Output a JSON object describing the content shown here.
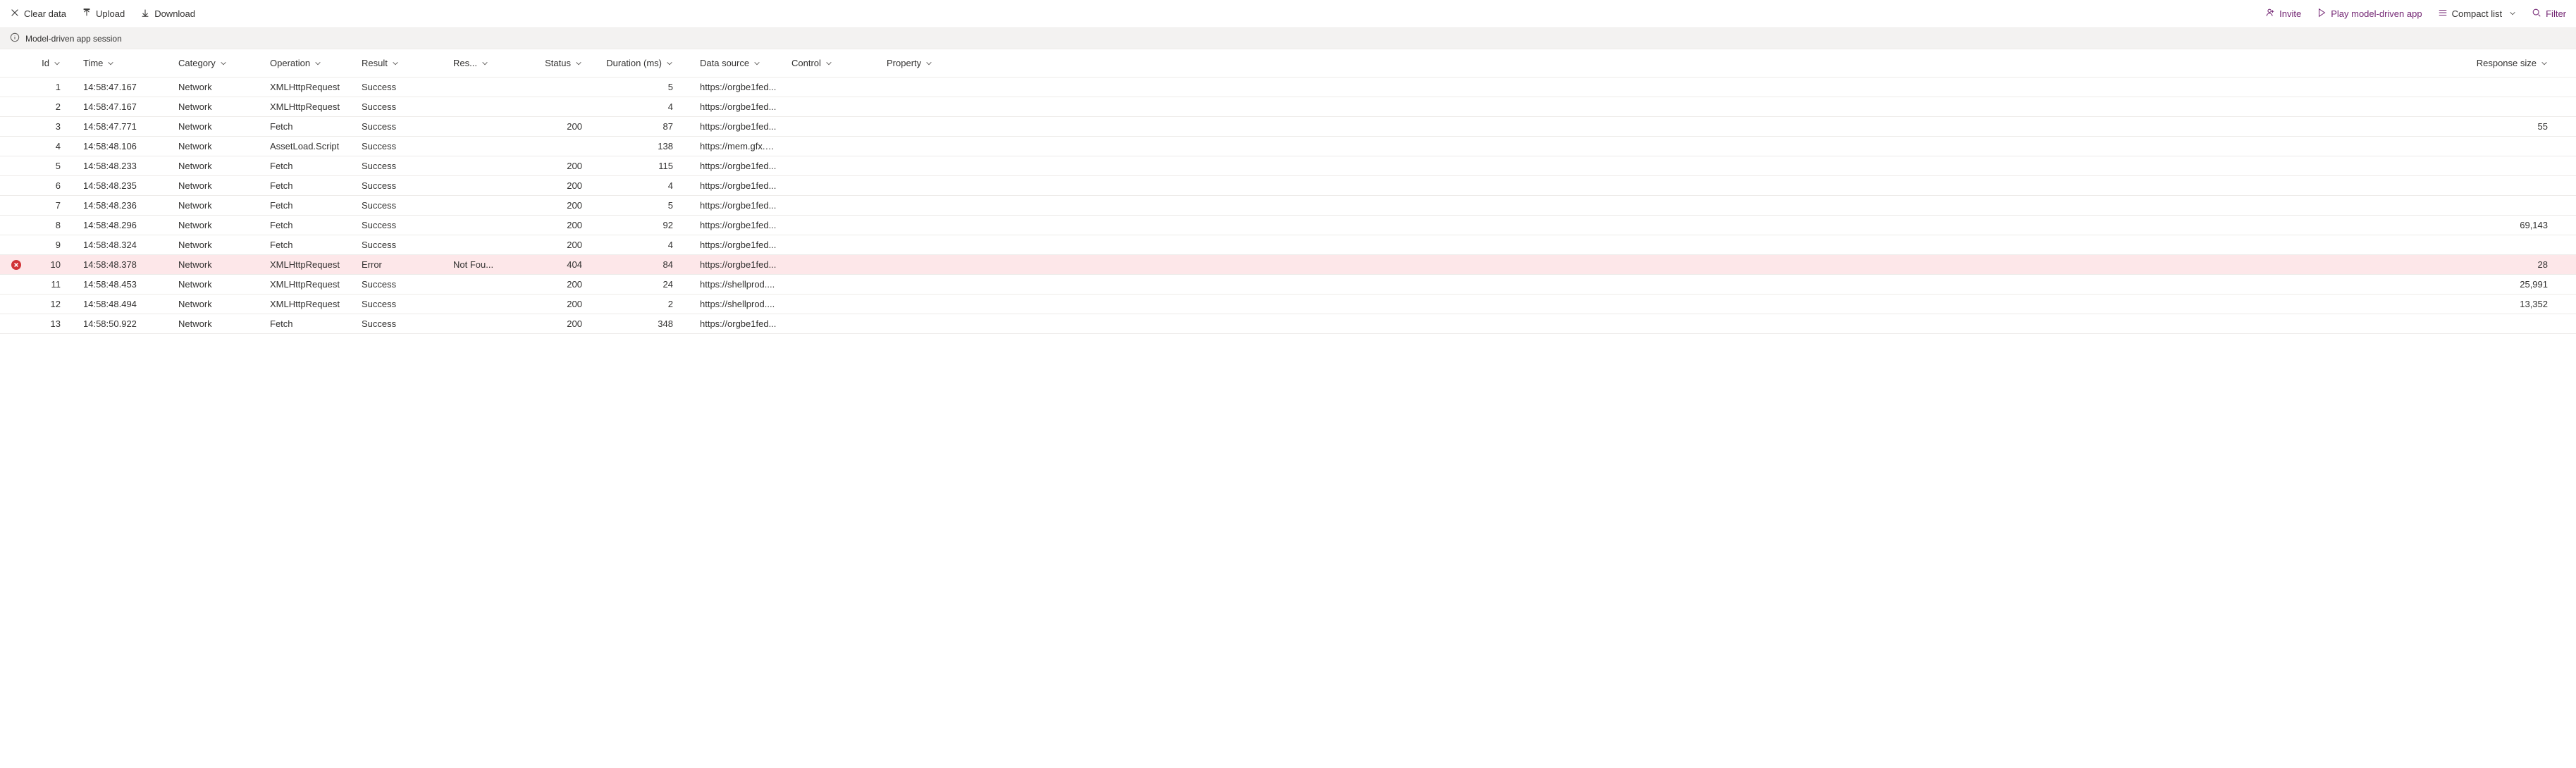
{
  "toolbar": {
    "clear_data": "Clear data",
    "upload": "Upload",
    "download": "Download",
    "invite": "Invite",
    "play": "Play model-driven app",
    "compact": "Compact list",
    "filter": "Filter"
  },
  "infobar": {
    "text": "Model-driven app session"
  },
  "columns": {
    "id": "Id",
    "time": "Time",
    "category": "Category",
    "operation": "Operation",
    "result": "Result",
    "res2": "Res...",
    "status": "Status",
    "duration": "Duration (ms)",
    "datasource": "Data source",
    "control": "Control",
    "property": "Property",
    "response_size": "Response size"
  },
  "rows": [
    {
      "id": "1",
      "time": "14:58:47.167",
      "cat": "Network",
      "op": "XMLHttpRequest",
      "result": "Success",
      "res2": "",
      "status": "",
      "dur": "5",
      "ds": "https://orgbe1fed...",
      "ctrl": "",
      "prop": "",
      "resp": "",
      "error": false
    },
    {
      "id": "2",
      "time": "14:58:47.167",
      "cat": "Network",
      "op": "XMLHttpRequest",
      "result": "Success",
      "res2": "",
      "status": "",
      "dur": "4",
      "ds": "https://orgbe1fed...",
      "ctrl": "",
      "prop": "",
      "resp": "",
      "error": false
    },
    {
      "id": "3",
      "time": "14:58:47.771",
      "cat": "Network",
      "op": "Fetch",
      "result": "Success",
      "res2": "",
      "status": "200",
      "dur": "87",
      "ds": "https://orgbe1fed...",
      "ctrl": "",
      "prop": "",
      "resp": "55",
      "error": false
    },
    {
      "id": "4",
      "time": "14:58:48.106",
      "cat": "Network",
      "op": "AssetLoad.Script",
      "result": "Success",
      "res2": "",
      "status": "",
      "dur": "138",
      "ds": "https://mem.gfx.m...",
      "ctrl": "",
      "prop": "",
      "resp": "",
      "error": false
    },
    {
      "id": "5",
      "time": "14:58:48.233",
      "cat": "Network",
      "op": "Fetch",
      "result": "Success",
      "res2": "",
      "status": "200",
      "dur": "115",
      "ds": "https://orgbe1fed...",
      "ctrl": "",
      "prop": "",
      "resp": "",
      "error": false
    },
    {
      "id": "6",
      "time": "14:58:48.235",
      "cat": "Network",
      "op": "Fetch",
      "result": "Success",
      "res2": "",
      "status": "200",
      "dur": "4",
      "ds": "https://orgbe1fed...",
      "ctrl": "",
      "prop": "",
      "resp": "",
      "error": false
    },
    {
      "id": "7",
      "time": "14:58:48.236",
      "cat": "Network",
      "op": "Fetch",
      "result": "Success",
      "res2": "",
      "status": "200",
      "dur": "5",
      "ds": "https://orgbe1fed...",
      "ctrl": "",
      "prop": "",
      "resp": "",
      "error": false
    },
    {
      "id": "8",
      "time": "14:58:48.296",
      "cat": "Network",
      "op": "Fetch",
      "result": "Success",
      "res2": "",
      "status": "200",
      "dur": "92",
      "ds": "https://orgbe1fed...",
      "ctrl": "",
      "prop": "",
      "resp": "69,143",
      "error": false
    },
    {
      "id": "9",
      "time": "14:58:48.324",
      "cat": "Network",
      "op": "Fetch",
      "result": "Success",
      "res2": "",
      "status": "200",
      "dur": "4",
      "ds": "https://orgbe1fed...",
      "ctrl": "",
      "prop": "",
      "resp": "",
      "error": false
    },
    {
      "id": "10",
      "time": "14:58:48.378",
      "cat": "Network",
      "op": "XMLHttpRequest",
      "result": "Error",
      "res2": "Not Fou...",
      "status": "404",
      "dur": "84",
      "ds": "https://orgbe1fed...",
      "ctrl": "",
      "prop": "",
      "resp": "28",
      "error": true
    },
    {
      "id": "11",
      "time": "14:58:48.453",
      "cat": "Network",
      "op": "XMLHttpRequest",
      "result": "Success",
      "res2": "",
      "status": "200",
      "dur": "24",
      "ds": "https://shellprod....",
      "ctrl": "",
      "prop": "",
      "resp": "25,991",
      "error": false
    },
    {
      "id": "12",
      "time": "14:58:48.494",
      "cat": "Network",
      "op": "XMLHttpRequest",
      "result": "Success",
      "res2": "",
      "status": "200",
      "dur": "2",
      "ds": "https://shellprod....",
      "ctrl": "",
      "prop": "",
      "resp": "13,352",
      "error": false
    },
    {
      "id": "13",
      "time": "14:58:50.922",
      "cat": "Network",
      "op": "Fetch",
      "result": "Success",
      "res2": "",
      "status": "200",
      "dur": "348",
      "ds": "https://orgbe1fed...",
      "ctrl": "",
      "prop": "",
      "resp": "",
      "error": false
    }
  ]
}
